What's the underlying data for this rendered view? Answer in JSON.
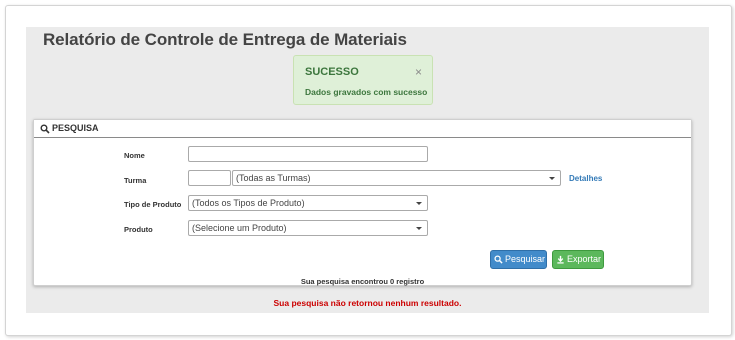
{
  "page": {
    "title": "Relatório de Controle de Entrega de Materiais"
  },
  "alert": {
    "title": "SUCESSO",
    "message": "Dados gravados com sucesso",
    "close_glyph": "×",
    "color": "#3c763d",
    "background": "#dff0d8"
  },
  "search_panel": {
    "title": "PESQUISA",
    "icon": "search-icon",
    "fields": {
      "nome": {
        "label": "Nome",
        "value": ""
      },
      "turma": {
        "label": "Turma",
        "code_value": "",
        "selected": "(Todas as Turmas)",
        "details_link": "Detalhes"
      },
      "tipo_produto": {
        "label": "Tipo de Produto",
        "selected": "(Todos os Tipos de Produto)"
      },
      "produto": {
        "label": "Produto",
        "selected": "(Selecione um Produto)"
      }
    },
    "buttons": {
      "search": {
        "label": "Pesquisar",
        "icon": "search-icon",
        "color": "#428bca"
      },
      "export": {
        "label": "Exportar",
        "icon": "download-icon",
        "color": "#5cb85c"
      }
    },
    "result_count_text": "Sua pesquisa encontrou 0 registro"
  },
  "no_results_message": "Sua pesquisa não retornou nenhum resultado."
}
